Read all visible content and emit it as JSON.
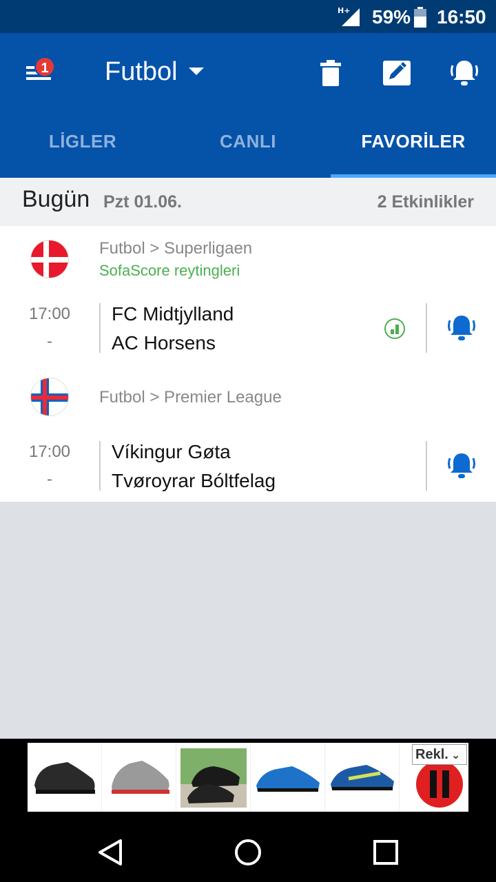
{
  "status_bar": {
    "network": "H+",
    "battery": "59%",
    "time": "16:50"
  },
  "app_bar": {
    "menu_badge": "1",
    "sport": "Futbol",
    "actions": [
      "trash-icon",
      "edit-icon",
      "bell-ring-icon"
    ],
    "accent_color": "#0552a9"
  },
  "tabs": [
    {
      "label": "LİGLER"
    },
    {
      "label": "CANLI"
    },
    {
      "label": "FAVORİLER",
      "active": true
    }
  ],
  "day_header": {
    "day": "Bugün",
    "date": "Pzt 01.06.",
    "count": "2 Etkinlikler"
  },
  "leagues": [
    {
      "flag": "denmark-flag-icon",
      "path": "Futbol > Superligaen",
      "subtitle": "SofaScore reytingleri",
      "matches": [
        {
          "time": "17:00",
          "status": "-",
          "home": "FC Midtjylland",
          "away": "AC Horsens",
          "has_rating": true
        }
      ]
    },
    {
      "flag": "faroe-islands-flag-icon",
      "path": "Futbol > Premier League",
      "subtitle": "",
      "matches": [
        {
          "time": "17:00",
          "status": "-",
          "home": "Víkingur Gøta",
          "away": "Tvøroyrar Bóltfelag",
          "has_rating": false
        }
      ]
    }
  ],
  "ad": {
    "label": "Rekl."
  }
}
